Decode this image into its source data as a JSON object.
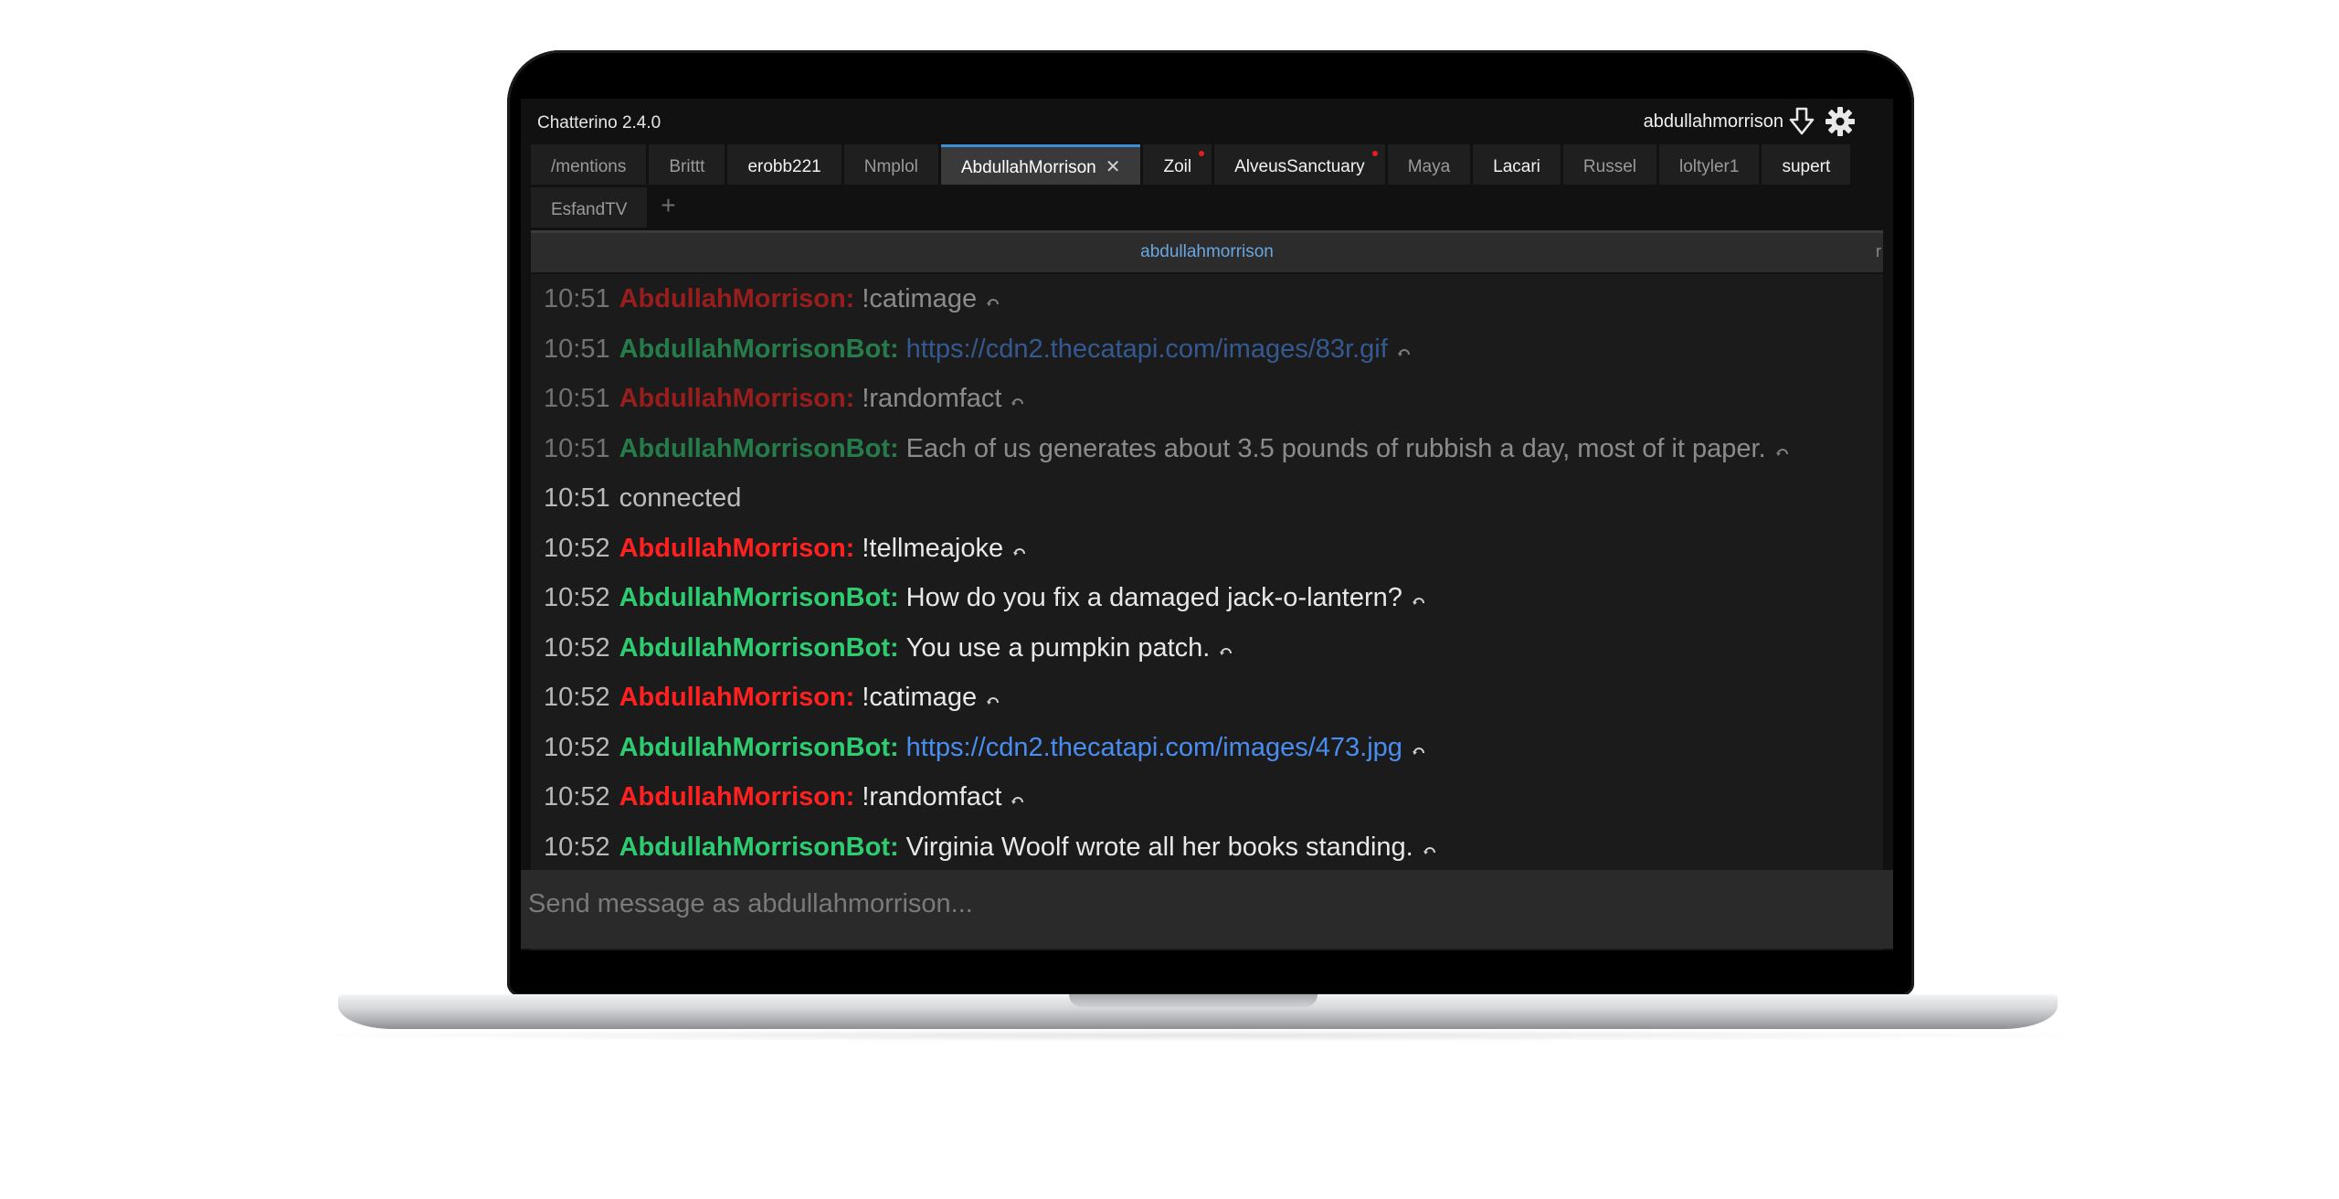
{
  "app": {
    "title": "Chatterino 2.4.0",
    "username": "abdullahmorrison"
  },
  "tabs_row1": [
    {
      "label": "/mentions",
      "bright": false
    },
    {
      "label": "Brittt",
      "bright": false
    },
    {
      "label": "erobb221",
      "bright": true
    },
    {
      "label": "Nmplol",
      "bright": false
    },
    {
      "label": "AbdullahMorrison",
      "bright": true,
      "active": true,
      "closable": true
    },
    {
      "label": "Zoil",
      "bright": true,
      "unread": true
    },
    {
      "label": "AlveusSanctuary",
      "bright": true,
      "unread": true
    },
    {
      "label": "Maya",
      "bright": false
    },
    {
      "label": "Lacari",
      "bright": true
    },
    {
      "label": "Russel",
      "bright": false
    },
    {
      "label": "loltyler1",
      "bright": false
    },
    {
      "label": "supert",
      "bright": true
    }
  ],
  "tabs_row2": [
    {
      "label": "EsfandTV",
      "bright": false
    }
  ],
  "tab_close_glyph": "✕",
  "tab_add_glyph": "+",
  "split": {
    "channel": "abdullahmorrison",
    "edge_text": "r"
  },
  "messages": [
    {
      "time": "10:51",
      "author": "AbdullahMorrison:",
      "color": "red",
      "text": "!catimage",
      "faded": true
    },
    {
      "time": "10:51",
      "author": "AbdullahMorrisonBot:",
      "color": "green",
      "text": "https://cdn2.thecatapi.com/images/83r.gif",
      "link": true,
      "faded": true
    },
    {
      "time": "10:51",
      "author": "AbdullahMorrison:",
      "color": "red",
      "text": "!randomfact",
      "faded": true
    },
    {
      "time": "10:51",
      "author": "AbdullahMorrisonBot:",
      "color": "green",
      "text": "Each of us generates about 3.5 pounds of rubbish a day, most of it paper.",
      "faded": true
    },
    {
      "time": "10:51",
      "author": "",
      "color": "",
      "text": "connected",
      "system": true
    },
    {
      "time": "10:52",
      "author": "AbdullahMorrison:",
      "color": "red",
      "text": "!tellmeajoke"
    },
    {
      "time": "10:52",
      "author": "AbdullahMorrisonBot:",
      "color": "green",
      "text": "How do you fix a damaged jack-o-lantern?"
    },
    {
      "time": "10:52",
      "author": "AbdullahMorrisonBot:",
      "color": "green",
      "text": "You use a pumpkin patch."
    },
    {
      "time": "10:52",
      "author": "AbdullahMorrison:",
      "color": "red",
      "text": "!catimage"
    },
    {
      "time": "10:52",
      "author": "AbdullahMorrisonBot:",
      "color": "green",
      "text": "https://cdn2.thecatapi.com/images/473.jpg",
      "link": true
    },
    {
      "time": "10:52",
      "author": "AbdullahMorrison:",
      "color": "red",
      "text": "!randomfact"
    },
    {
      "time": "10:52",
      "author": "AbdullahMorrisonBot:",
      "color": "green",
      "text": "Virginia Woolf wrote all her books standing."
    }
  ],
  "input": {
    "placeholder": "Send message as abdullahmorrison..."
  },
  "colors": {
    "accent": "#3a8fd6",
    "author_red": "#ff2020",
    "author_green": "#2ecc71",
    "link": "#4a8df0",
    "unread": "#e02020"
  }
}
